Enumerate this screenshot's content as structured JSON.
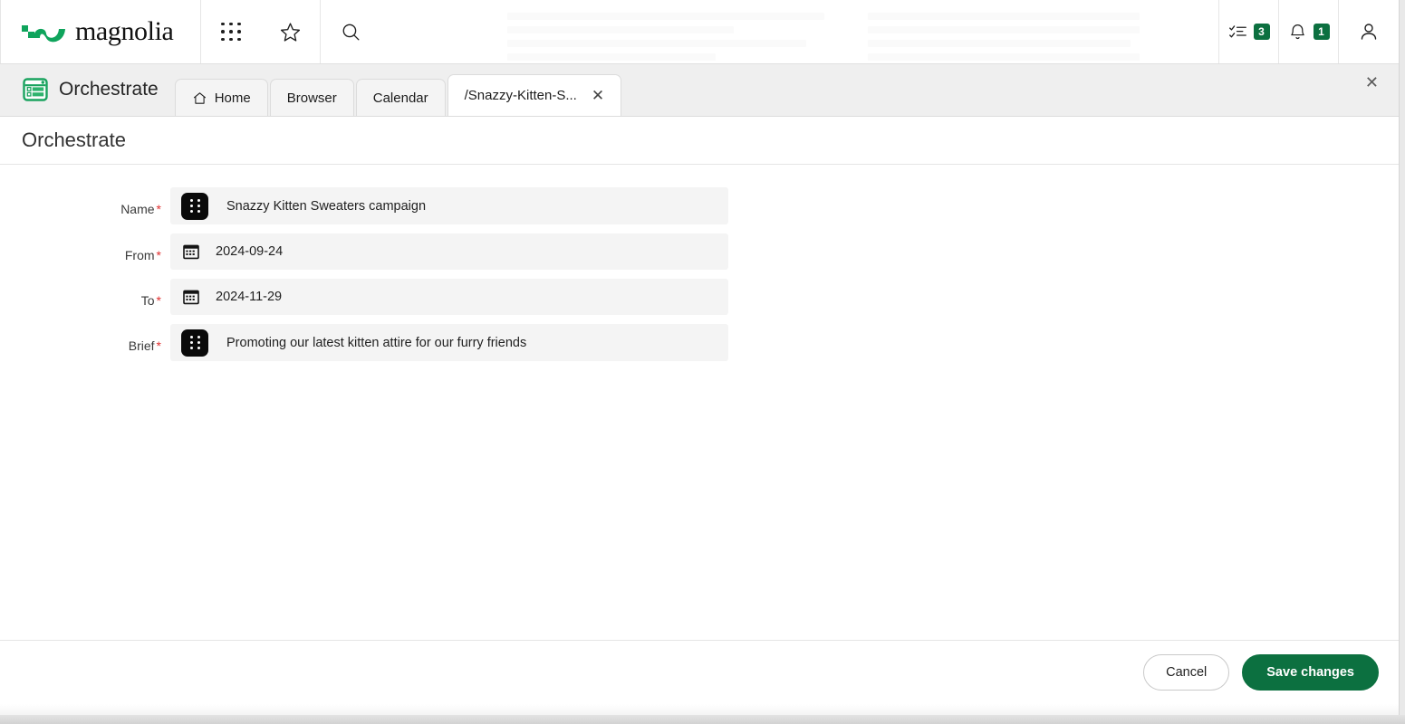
{
  "app": {
    "brand_name": "magnolia",
    "brand_color": "#0fa45c",
    "accent_green": "#0c7040"
  },
  "topbar": {
    "apps_icon": "grid-apps-icon",
    "favorites_icon": "star-icon",
    "search_icon": "search-icon",
    "tasks": {
      "icon": "tasks-checklist-icon",
      "count": "3"
    },
    "notifications": {
      "icon": "bell-icon",
      "count": "1"
    },
    "profile_icon": "user-avatar-icon"
  },
  "workspace": {
    "app_icon": "orchestrate-app-icon",
    "app_title": "Orchestrate",
    "close_label": "✕",
    "tabs": [
      {
        "label": "Home",
        "icon": "home-icon",
        "active": false,
        "closable": false
      },
      {
        "label": "Browser",
        "icon": "",
        "active": false,
        "closable": false
      },
      {
        "label": "Calendar",
        "icon": "",
        "active": false,
        "closable": false
      },
      {
        "label": "/Snazzy-Kitten-S...",
        "icon": "",
        "active": true,
        "closable": true,
        "close_label": "✕"
      }
    ]
  },
  "page": {
    "title": "Orchestrate"
  },
  "form": {
    "fields": [
      {
        "label": "Name",
        "required": true,
        "required_mark": "*",
        "icon": "drag-handle-icon",
        "icon_type": "handle",
        "value": "Snazzy Kitten Sweaters campaign"
      },
      {
        "label": "From",
        "required": true,
        "required_mark": "*",
        "icon": "calendar-icon",
        "icon_type": "calendar",
        "value": "2024-09-24"
      },
      {
        "label": "To",
        "required": true,
        "required_mark": "*",
        "icon": "calendar-icon",
        "icon_type": "calendar",
        "value": "2024-11-29"
      },
      {
        "label": "Brief",
        "required": true,
        "required_mark": "*",
        "icon": "drag-handle-icon",
        "icon_type": "handle",
        "value": "Promoting our latest kitten attire for our furry friends"
      }
    ]
  },
  "footer": {
    "cancel_label": "Cancel",
    "save_label": "Save changes"
  }
}
